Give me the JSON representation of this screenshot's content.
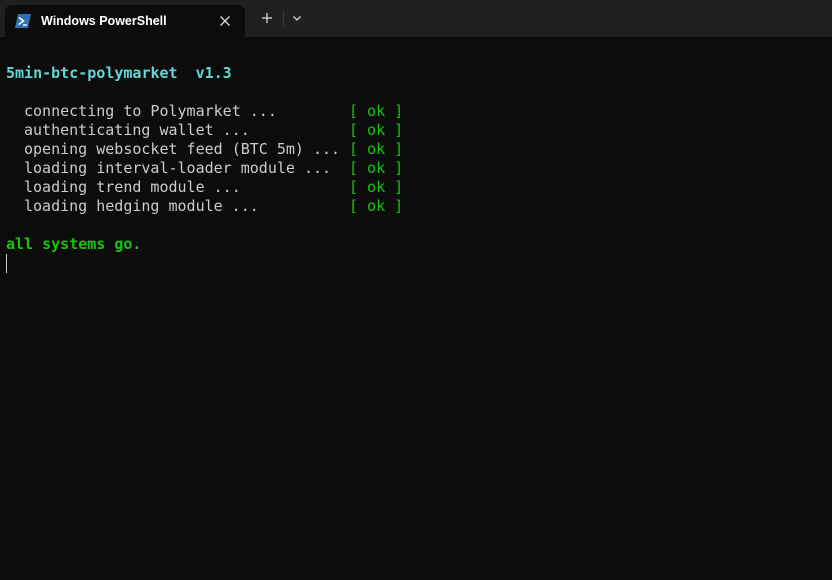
{
  "tab": {
    "title": "Windows PowerShell",
    "icon": "powershell-icon",
    "close_icon": "close-icon",
    "new_tab_icon": "plus-icon",
    "dropdown_icon": "chevron-down-icon"
  },
  "terminal": {
    "banner_name": "5min-btc-polymarket",
    "banner_version": "v1.3",
    "steps": [
      {
        "label": "connecting to Polymarket ...",
        "status": "[ ok ]"
      },
      {
        "label": "authenticating wallet ...",
        "status": "[ ok ]"
      },
      {
        "label": "opening websocket feed (BTC 5m) ...",
        "status": "[ ok ]"
      },
      {
        "label": "loading interval-loader module ...",
        "status": "[ ok ]"
      },
      {
        "label": "loading trend module ...",
        "status": "[ ok ]"
      },
      {
        "label": "loading hedging module ...",
        "status": "[ ok ]"
      }
    ],
    "final_message": "all systems go."
  },
  "colors": {
    "background": "#0c0c0c",
    "tabbar": "#202020",
    "banner": "#61d6d6",
    "ok_green": "#16c60c",
    "text": "#cccccc",
    "powershell_blue": "#2b5797"
  }
}
